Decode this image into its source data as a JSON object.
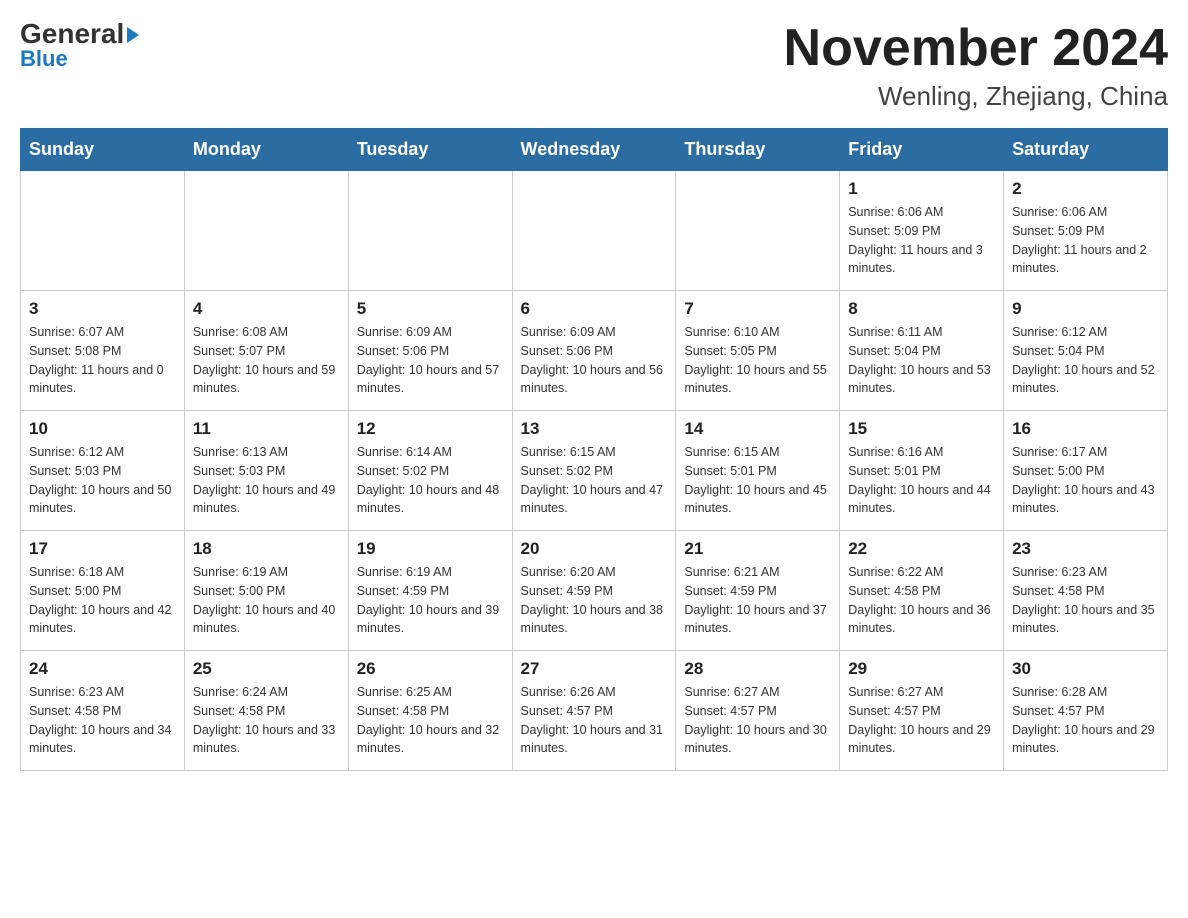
{
  "logo": {
    "general": "General",
    "blue": "Blue",
    "triangle": "▲"
  },
  "title": "November 2024",
  "subtitle": "Wenling, Zhejiang, China",
  "days_of_week": [
    "Sunday",
    "Monday",
    "Tuesday",
    "Wednesday",
    "Thursday",
    "Friday",
    "Saturday"
  ],
  "weeks": [
    [
      {
        "day": "",
        "info": ""
      },
      {
        "day": "",
        "info": ""
      },
      {
        "day": "",
        "info": ""
      },
      {
        "day": "",
        "info": ""
      },
      {
        "day": "",
        "info": ""
      },
      {
        "day": "1",
        "info": "Sunrise: 6:06 AM\nSunset: 5:09 PM\nDaylight: 11 hours and 3 minutes."
      },
      {
        "day": "2",
        "info": "Sunrise: 6:06 AM\nSunset: 5:09 PM\nDaylight: 11 hours and 2 minutes."
      }
    ],
    [
      {
        "day": "3",
        "info": "Sunrise: 6:07 AM\nSunset: 5:08 PM\nDaylight: 11 hours and 0 minutes."
      },
      {
        "day": "4",
        "info": "Sunrise: 6:08 AM\nSunset: 5:07 PM\nDaylight: 10 hours and 59 minutes."
      },
      {
        "day": "5",
        "info": "Sunrise: 6:09 AM\nSunset: 5:06 PM\nDaylight: 10 hours and 57 minutes."
      },
      {
        "day": "6",
        "info": "Sunrise: 6:09 AM\nSunset: 5:06 PM\nDaylight: 10 hours and 56 minutes."
      },
      {
        "day": "7",
        "info": "Sunrise: 6:10 AM\nSunset: 5:05 PM\nDaylight: 10 hours and 55 minutes."
      },
      {
        "day": "8",
        "info": "Sunrise: 6:11 AM\nSunset: 5:04 PM\nDaylight: 10 hours and 53 minutes."
      },
      {
        "day": "9",
        "info": "Sunrise: 6:12 AM\nSunset: 5:04 PM\nDaylight: 10 hours and 52 minutes."
      }
    ],
    [
      {
        "day": "10",
        "info": "Sunrise: 6:12 AM\nSunset: 5:03 PM\nDaylight: 10 hours and 50 minutes."
      },
      {
        "day": "11",
        "info": "Sunrise: 6:13 AM\nSunset: 5:03 PM\nDaylight: 10 hours and 49 minutes."
      },
      {
        "day": "12",
        "info": "Sunrise: 6:14 AM\nSunset: 5:02 PM\nDaylight: 10 hours and 48 minutes."
      },
      {
        "day": "13",
        "info": "Sunrise: 6:15 AM\nSunset: 5:02 PM\nDaylight: 10 hours and 47 minutes."
      },
      {
        "day": "14",
        "info": "Sunrise: 6:15 AM\nSunset: 5:01 PM\nDaylight: 10 hours and 45 minutes."
      },
      {
        "day": "15",
        "info": "Sunrise: 6:16 AM\nSunset: 5:01 PM\nDaylight: 10 hours and 44 minutes."
      },
      {
        "day": "16",
        "info": "Sunrise: 6:17 AM\nSunset: 5:00 PM\nDaylight: 10 hours and 43 minutes."
      }
    ],
    [
      {
        "day": "17",
        "info": "Sunrise: 6:18 AM\nSunset: 5:00 PM\nDaylight: 10 hours and 42 minutes."
      },
      {
        "day": "18",
        "info": "Sunrise: 6:19 AM\nSunset: 5:00 PM\nDaylight: 10 hours and 40 minutes."
      },
      {
        "day": "19",
        "info": "Sunrise: 6:19 AM\nSunset: 4:59 PM\nDaylight: 10 hours and 39 minutes."
      },
      {
        "day": "20",
        "info": "Sunrise: 6:20 AM\nSunset: 4:59 PM\nDaylight: 10 hours and 38 minutes."
      },
      {
        "day": "21",
        "info": "Sunrise: 6:21 AM\nSunset: 4:59 PM\nDaylight: 10 hours and 37 minutes."
      },
      {
        "day": "22",
        "info": "Sunrise: 6:22 AM\nSunset: 4:58 PM\nDaylight: 10 hours and 36 minutes."
      },
      {
        "day": "23",
        "info": "Sunrise: 6:23 AM\nSunset: 4:58 PM\nDaylight: 10 hours and 35 minutes."
      }
    ],
    [
      {
        "day": "24",
        "info": "Sunrise: 6:23 AM\nSunset: 4:58 PM\nDaylight: 10 hours and 34 minutes."
      },
      {
        "day": "25",
        "info": "Sunrise: 6:24 AM\nSunset: 4:58 PM\nDaylight: 10 hours and 33 minutes."
      },
      {
        "day": "26",
        "info": "Sunrise: 6:25 AM\nSunset: 4:58 PM\nDaylight: 10 hours and 32 minutes."
      },
      {
        "day": "27",
        "info": "Sunrise: 6:26 AM\nSunset: 4:57 PM\nDaylight: 10 hours and 31 minutes."
      },
      {
        "day": "28",
        "info": "Sunrise: 6:27 AM\nSunset: 4:57 PM\nDaylight: 10 hours and 30 minutes."
      },
      {
        "day": "29",
        "info": "Sunrise: 6:27 AM\nSunset: 4:57 PM\nDaylight: 10 hours and 29 minutes."
      },
      {
        "day": "30",
        "info": "Sunrise: 6:28 AM\nSunset: 4:57 PM\nDaylight: 10 hours and 29 minutes."
      }
    ]
  ]
}
